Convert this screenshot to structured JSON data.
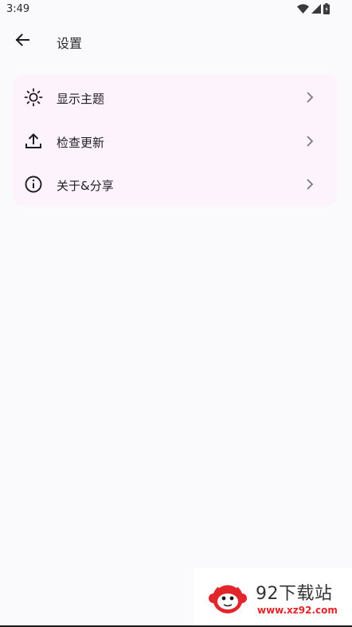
{
  "status_bar": {
    "time": "3:49",
    "icons": [
      "wifi-icon",
      "signal-icon",
      "battery-icon"
    ]
  },
  "app_bar": {
    "back_icon": "arrow-left-icon",
    "title": "设置"
  },
  "settings": {
    "items": [
      {
        "icon": "sun-icon",
        "label": "显示主题"
      },
      {
        "icon": "upload-icon",
        "label": "检查更新"
      },
      {
        "icon": "info-icon",
        "label": "关于&分享"
      }
    ]
  },
  "watermark": {
    "title": "92下载站",
    "url": "www.xz92.com",
    "accent": "#e0262b"
  },
  "colors": {
    "background": "#faf9fb",
    "card": "#fcf3fc",
    "text": "#1f1e22"
  }
}
